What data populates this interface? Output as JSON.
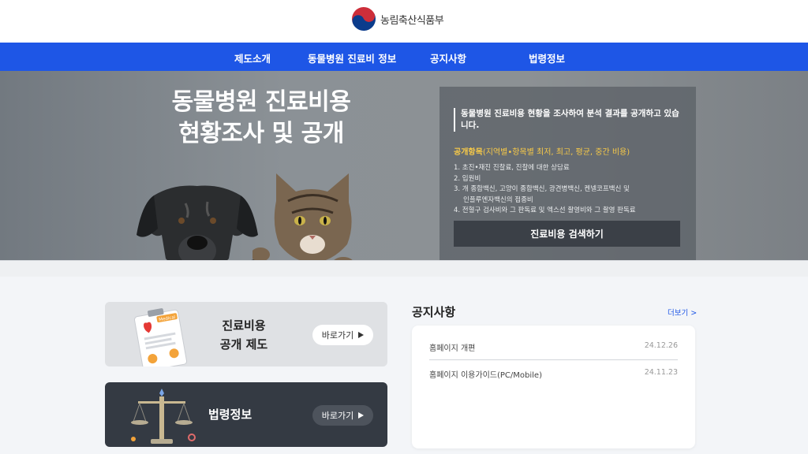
{
  "header": {
    "logo_text": "농림축산식품부"
  },
  "nav": {
    "items": [
      {
        "label": "제도소개"
      },
      {
        "label": "동물병원 진료비 정보"
      },
      {
        "label": "공지사항"
      },
      {
        "label": "법령정보"
      }
    ]
  },
  "hero": {
    "title_line1": "동물병원 진료비용",
    "title_line2": "현황조사 및 공개",
    "info": {
      "headline": "동물병원 진료비용 현황을 조사하여 분석 결과를 공개하고 있습니다.",
      "sub_label": "공개항목",
      "sub_detail": "(지역별•항목별 최저, 최고, 평균, 중간 비용)",
      "items": [
        "1. 초진•재진 진찰료, 진찰에 대한 상담료",
        "2. 입원비",
        "3. 개 종합백신, 고양이 종합백신, 광견병백신, 켄넬코프백신 및",
        "인플루엔자백신의 접종비",
        "4. 전혈구 검사비와 그 판독료 및 엑스선 촬영비와 그 촬영 판독료"
      ],
      "search_button": "진료비용 검색하기"
    }
  },
  "cards": [
    {
      "title_line1": "진료비용",
      "title_line2": "공개 제도",
      "button": "바로가기",
      "badge": "Medical"
    },
    {
      "title": "법령정보",
      "button": "바로가기"
    }
  ],
  "notice": {
    "title": "공지사항",
    "more": "더보기 >",
    "rows": [
      {
        "title": "홈페이지 개편",
        "date": "24.12.26"
      },
      {
        "title": "홈페이지 이용가이드(PC/Mobile)",
        "date": "24.11.23"
      }
    ]
  },
  "colors": {
    "nav_blue": "#1e56e6",
    "accent_yellow": "#f7c948",
    "dark_card": "#343a43"
  }
}
